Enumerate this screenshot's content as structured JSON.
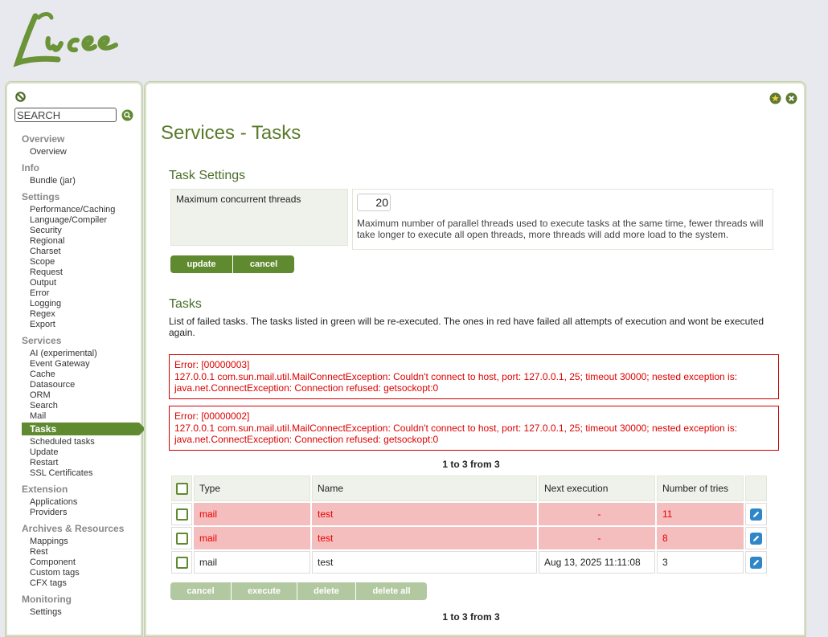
{
  "app": {
    "brand": "Lucee"
  },
  "sidebar": {
    "search_placeholder": "SEARCH",
    "groups": [
      {
        "title": "Overview",
        "items": [
          "Overview"
        ]
      },
      {
        "title": "Info",
        "items": [
          "Bundle (jar)"
        ]
      },
      {
        "title": "Settings",
        "items": [
          "Performance/Caching",
          "Language/Compiler",
          "Security",
          "Regional",
          "Charset",
          "Scope",
          "Request",
          "Output",
          "Error",
          "Logging",
          "Regex",
          "Export"
        ]
      },
      {
        "title": "Services",
        "items": [
          "AI (experimental)",
          "Event Gateway",
          "Cache",
          "Datasource",
          "ORM",
          "Search",
          "Mail",
          "Tasks",
          "Scheduled tasks",
          "Update",
          "Restart",
          "SSL Certificates"
        ]
      },
      {
        "title": "Extension",
        "items": [
          "Applications",
          "Providers"
        ]
      },
      {
        "title": "Archives & Resources",
        "items": [
          "Mappings",
          "Rest",
          "Component",
          "Custom tags",
          "CFX tags"
        ]
      },
      {
        "title": "Monitoring",
        "items": [
          "Settings"
        ]
      }
    ],
    "active_item": "Tasks"
  },
  "page": {
    "title": "Services - Tasks"
  },
  "task_settings": {
    "title": "Task Settings",
    "label": "Maximum concurrent threads",
    "value": "20",
    "description": "Maximum number of parallel threads used to execute tasks at the same time, fewer threads will take longer to execute all open threads, more threads will add more load to the system.",
    "buttons": {
      "update": "update",
      "cancel": "cancel"
    }
  },
  "tasks": {
    "title": "Tasks",
    "description": "List of failed tasks. The tasks listed in green will be re-executed. The ones in red have failed all attempts of execution and wont be executed again.",
    "errors": [
      {
        "code": "Error: [00000003]",
        "message": "127.0.0.1 com.sun.mail.util.MailConnectException: Couldn't connect to host, port: 127.0.0.1, 25; timeout 30000; nested exception is: java.net.ConnectException: Connection refused: getsockopt:0"
      },
      {
        "code": "Error: [00000002]",
        "message": "127.0.0.1 com.sun.mail.util.MailConnectException: Couldn't connect to host, port: 127.0.0.1, 25; timeout 30000; nested exception is: java.net.ConnectException: Connection refused: getsockopt:0"
      }
    ],
    "pager": "1 to 3 from 3",
    "columns": {
      "type": "Type",
      "name": "Name",
      "next": "Next execution",
      "tries": "Number of tries"
    },
    "rows": [
      {
        "type": "mail",
        "name": "test",
        "next": "-",
        "tries": "11",
        "status": "failed"
      },
      {
        "type": "mail",
        "name": "test",
        "next": "-",
        "tries": "8",
        "status": "failed"
      },
      {
        "type": "mail",
        "name": "test",
        "next": "Aug 13, 2025 11:11:08",
        "tries": "3",
        "status": "pending"
      }
    ],
    "buttons": {
      "cancel": "cancel",
      "execute": "execute",
      "delete": "delete",
      "delete_all": "delete all"
    }
  },
  "colors": {
    "accent": "#5f8a2f",
    "title": "#5a7a2b",
    "error": "#dd0000",
    "failed_row": "#f4bebe"
  }
}
